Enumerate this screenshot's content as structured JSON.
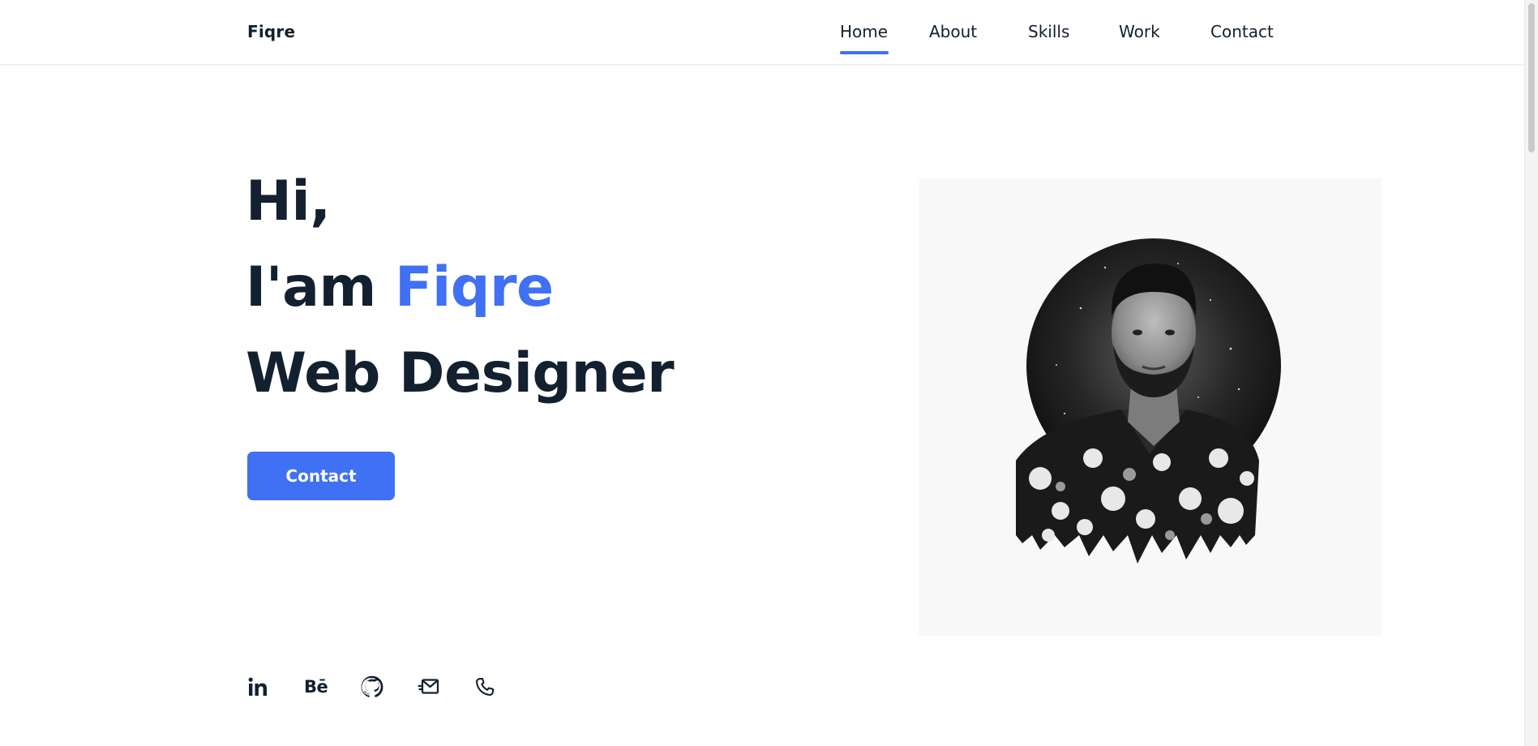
{
  "header": {
    "logo": "Fiqre",
    "nav": [
      {
        "label": "Home",
        "active": true
      },
      {
        "label": "About",
        "active": false
      },
      {
        "label": "Skills",
        "active": false
      },
      {
        "label": "Work",
        "active": false
      },
      {
        "label": "Contact",
        "active": false
      }
    ]
  },
  "hero": {
    "line1": "Hi,",
    "line2_prefix": "I'am ",
    "line2_name": "Fiqre",
    "line3": "Web Designer",
    "button_label": "Contact"
  },
  "socials": [
    {
      "icon": "linkedin-icon"
    },
    {
      "icon": "behance-icon",
      "text": "Bē"
    },
    {
      "icon": "github-icon"
    },
    {
      "icon": "mail-icon"
    },
    {
      "icon": "phone-icon"
    }
  ],
  "photo": {
    "icon": "profile-photo"
  },
  "colors": {
    "accent": "#4070f4",
    "text": "#12202f",
    "card_bg": "#f8f8f8"
  }
}
